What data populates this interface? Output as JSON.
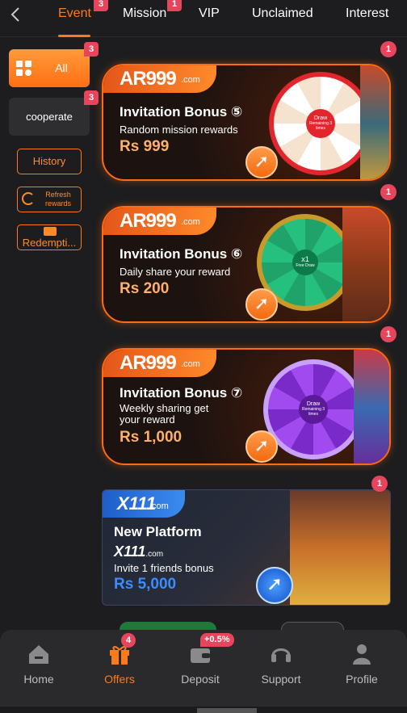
{
  "tabs": [
    {
      "label": "Event",
      "badge": "3",
      "active": true
    },
    {
      "label": "Mission",
      "badge": "1"
    },
    {
      "label": "VIP"
    },
    {
      "label": "Unclaimed"
    },
    {
      "label": "Interest"
    }
  ],
  "sidebar": {
    "all_label": "All",
    "all_badge": "3",
    "cooperate_label": "cooperate",
    "cooperate_badge": "3",
    "history_label": "History",
    "refresh_label": "Refresh rewards",
    "redemption_label": "Redempti..."
  },
  "banners": [
    {
      "brand": "AR999",
      "brand_suffix": ".com",
      "title": "Invitation Bonus",
      "num": "⑤",
      "subtitle": "Random mission rewards",
      "amount": "Rs 999",
      "badge": "1"
    },
    {
      "brand": "AR999",
      "brand_suffix": ".com",
      "title": "Invitation Bonus",
      "num": "⑥",
      "subtitle": "Daily share your reward",
      "amount": "Rs 200",
      "badge": "1"
    },
    {
      "brand": "AR999",
      "brand_suffix": ".com",
      "title": "Invitation Bonus",
      "num": "⑦",
      "subtitle": "Weekly sharing get",
      "subtitle2": "your reward",
      "amount": "Rs 1,000",
      "badge": "1"
    },
    {
      "brand": "X111",
      "brand_suffix": ".com",
      "title": "New Platform",
      "subtitle": "Invite 1 friends bonus",
      "amount": "Rs 5,000",
      "badge": "1"
    }
  ],
  "wheels": [
    {
      "hub_text": "Draw",
      "hub_sub": "Remaining 3 times"
    },
    {
      "hub_text": "x1",
      "hub_sub": "Free Draw"
    },
    {
      "hub_text": "Draw",
      "hub_sub": "Remaining 3 times"
    }
  ],
  "nav": [
    {
      "label": "Home",
      "icon": "home-icon"
    },
    {
      "label": "Offers",
      "icon": "gift-icon",
      "badge": "4",
      "active": true
    },
    {
      "label": "Deposit",
      "icon": "wallet-icon",
      "badge": "+0.5%"
    },
    {
      "label": "Support",
      "icon": "headset-icon"
    },
    {
      "label": "Profile",
      "icon": "person-icon"
    }
  ],
  "colors": {
    "accent": "#ff7a1a",
    "badge": "#e7455c",
    "background": "#1d1d1f"
  }
}
